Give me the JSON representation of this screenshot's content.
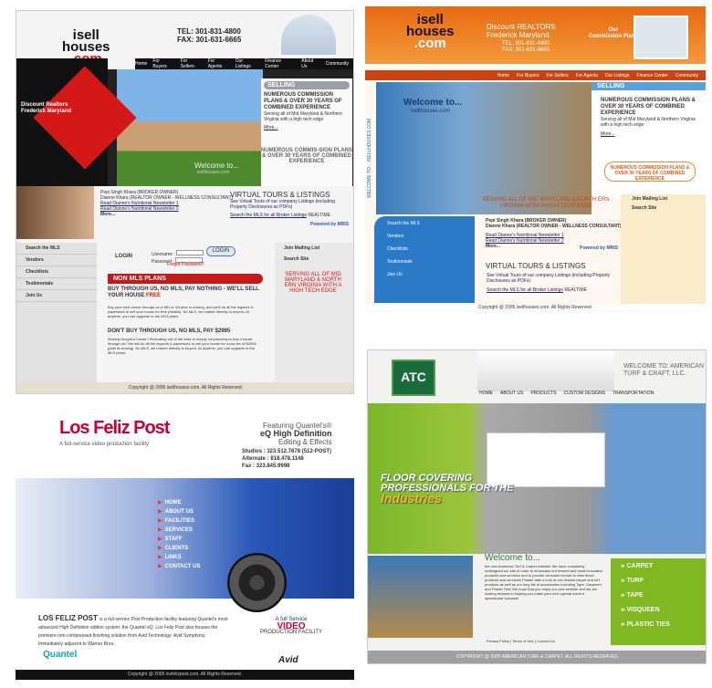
{
  "p1": {
    "logo1": "isell",
    "logo2": "houses",
    "logo3": ".com",
    "tel": "TEL: 301-831-4800",
    "fax": "FAX: 301-631-6665",
    "nav": [
      "Home",
      "For Buyers",
      "For Sellers",
      "For Agents",
      "Our Listings",
      "Finance Center",
      "About Us",
      "Community"
    ],
    "discount": "Discount Realtors",
    "frederick": "Frederick Maryland",
    "welcome": "Welcome to...",
    "welcome_site": "isellhouses.com",
    "selling": "SELLING",
    "selling_head": "NUMEROUS COMMISSION PLANS & OVER 30 YEARS OF COMBINED EXPERIENCE",
    "selling_text": "Serving all of Mid Maryland & Northern Virginia with a high tech edge",
    "more": "More...",
    "numc": "NUMEROUS COMMIS-SION PLANS & OVER 30 YEARS OF COMBINED EXPERIENCE",
    "broker1": "Pepi Singh Khara (BROKER OWNER)",
    "broker2": "Dianne Khara (REALTOR OWNER - WELLNESS CONSULTANT)",
    "news1": "Read Dianne's Nutritional Newsletter 1",
    "news2": "Read Dianne's Nutritional Newsletter 2",
    "news_more": "More...",
    "tours": "VIRTUAL TOURS & LISTINGS",
    "tours_text": "See Virtual Tours of our company Listings (including Property Disclosures as PDFs)",
    "tours_search": "Search the MLS for all Broker Listings",
    "realtime": "REALTIME",
    "powered": "Powered by MRIS",
    "side": [
      "Search the MLS",
      "Vendors",
      "Checklists",
      "Testimonials",
      "Join Us"
    ],
    "login_label": "LOGIN",
    "username_label": "Username :",
    "password_label": "Password :",
    "login_btn": "LOGIN",
    "forgot": "Forgot Password?",
    "rside": [
      "Join Mailing List",
      "Search Site"
    ],
    "serv": "SERVING ALL OF MID MARYLAND & NORTH ERN VIRGINIA WITH A HIGH TECH EDGE",
    "nonmls": "NON MLS PLANS",
    "buy": "BUY THROUGH US, NO MLS, PAY NOTHING - WE'LL SELL YOUR HOUSE",
    "buy_free": "FREE",
    "buy_text": "Buy your next house through us in MD or VA prior to closing, and we'll do all the legwork & paperwork to sell your house for free (details). No MLS, we market directly to buyers. At anytime, you can upgrade to the MLS plans.",
    "dont": "DON'T BUY THROUGH US, NO MLS, PAY $2995",
    "dont_text": "Already bought a house? Relocating out of the area or simply not planning to buy a house through us? We will do all the legwork & paperwork to sell your house for a low fee of $2995 (paid at closing). No MLS, we market directly to buyers. At anytime, you can upgrade to the MLS plans.",
    "copy": "Copyright @ 2005 isellhouses.com. All Rights Reserved."
  },
  "p2": {
    "logo1": "isell",
    "logo2": "houses",
    "logo3": ".com",
    "disc1": "Discount REALTORS",
    "disc2": "Frederick Maryland",
    "tel": "TEL: 301-831-4800",
    "fax": "FAX: 301-631-6665",
    "plan1": "Our",
    "plan2": "Commission Plans",
    "nav": [
      "Home",
      "For Buyers",
      "For Sellers",
      "For Agents",
      "Our Listings",
      "Finance Center",
      "Community"
    ],
    "vert": "WELCOME TO... ISELLHOUSES.COM",
    "welcome": "Welcome to...",
    "welcome_site": "isellhouses.com",
    "selling": "SELLING",
    "selling_head": "NUMEROUS COMMISSION PLANS & OVER 30 YEARS OF COMBINED EXPERIENCE",
    "selling_text": "Serving all of Mid Maryland & Northern Virginia with a high tech edge",
    "more": "More...",
    "numc": "NUMEROUS COMMISSION PLANS & OVER 30 YEARS OF COMBINED EXPERIENCE",
    "serv": "SERVING ALL OF MID MARYLAND & NORTH ERN VIRGINIA WITH A HIGH TECH EDGE",
    "side": [
      "Search the MLS",
      "Vendors",
      "Checklists",
      "Testimonials",
      "Join Us"
    ],
    "broker1": "Pepi Singh Khara (BROKER OWNER)",
    "broker2": "Dianne Khara (REALTOR OWNER - WELLNESS CONSULTANT)",
    "news1": "Read Dianne's Nutritional Newsletter 1",
    "news2": "Read Dianne's Nutritional Newsletter 2",
    "news_more": "More...",
    "powered": "Powered by MRIS",
    "tours": "VIRTUAL TOURS & LISTINGS",
    "tours_text": "See Virtual Tours of our company Listings (including Property Disclosures as PDFs)",
    "tours_search": "Search the MLS for all Broker Listings",
    "realtime": "REALTIME",
    "rside": [
      "Join Mailing List",
      "Search Site"
    ],
    "copy": "Copyright @ 2005 isellhouses.com. All Rights Reserved."
  },
  "p3": {
    "logo": "Los Feliz Post",
    "logo_sub": "A full-service video production facility",
    "feat1": "Featuring Quantel's®",
    "feat2": "eQ High Definition",
    "feat3": "Editing & Effects",
    "studio": "Studios : 323.512.7678 (512-POST)",
    "alternate": "Alternate : 818.478.1148",
    "fax": "Fax : 323.845.9998",
    "nav": [
      "HOME",
      "ABOUT US",
      "FACILITIES",
      "SERVICES",
      "STAFF",
      "CLIENTS",
      "LINKS",
      "CONTACT US"
    ],
    "lfp_title": "LOS FELIZ POST",
    "lfp_text": "is a full-service Post Production facility featuring Quantel's most advanced High Definition edition system: the Quantel eQ. Los Feliz Post also houses the premiere non-compressed finishing solution from Avid Technology: Avid Symphony. Immediately adjacent to Warner Bros.",
    "video1": "A full Service",
    "video2": "VIDEO",
    "video3": "PRODUCTION FACILITY",
    "quantel": "Quantel",
    "avid": "Avid",
    "copy": "Copyright @ 2005 losfelizpost.com. All Rights Reserved."
  },
  "p4": {
    "logo": "ATC",
    "welcome": "WELCOME TO: AMERICAN TURF & CRAFT, LLC.",
    "nav": [
      "HOME",
      "ABOUT US",
      "PRODUCTS",
      "CUSTOM DESIGNS",
      "TRANSPORTATION"
    ],
    "floor1": "FLOOR COVERING",
    "floor2": "PROFESSIONALS FOR THE",
    "floor3": "Industries",
    "welc": "Welcome to...",
    "welct": "the new American Turf & Carpet website! We have completely redesigned our site in order to showcase our newest and most innovative products and services and to provide an easier format to view these products and services! Please take a look at our newest carpet and turf products as well as our long list of accessories including Tape, Visqueen, and Plastic Ties! We hope that you enjoy our new website and we are looking forward to helping you make your next special event a spectacular success!",
    "links": "Privacy Policy | Terms of Use | Contact Us",
    "rside": [
      "CARPET",
      "TURF",
      "TAPE",
      "VISQUEEN",
      "PLASTIC TIES"
    ],
    "copy": "COPYRIGHT @ 2005 AMERICAN TURF & CARPET. ALL RIGHTS RESERVED."
  }
}
